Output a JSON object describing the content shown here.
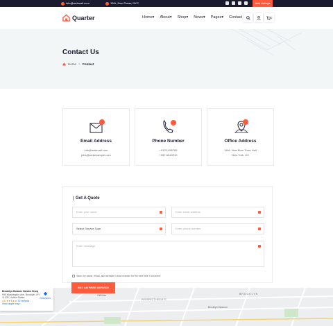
{
  "topbar": {
    "email": "info@webmail.com",
    "location": "15/A, Nest Tower, NYC",
    "add_listing": "Add Listings"
  },
  "header": {
    "logo_text": "Quarter",
    "nav": [
      "Home",
      "About",
      "Shop",
      "News",
      "Pages",
      "Contact"
    ],
    "cart_count": "2"
  },
  "banner": {
    "title": "Contact Us",
    "breadcrumb_home": "Home",
    "breadcrumb_sep": ">",
    "breadcrumb_current": "Contact"
  },
  "cards": [
    {
      "title": "Email Address",
      "line1": "info@webmail.com",
      "line2": "jobs@webexample.com",
      "icon": "email-icon"
    },
    {
      "title": "Phone Number",
      "line1": "+0123-456789",
      "line2": "+987-6543210",
      "icon": "phone-icon"
    },
    {
      "title": "Office Address",
      "line1": "18/A, New Born Town Hall",
      "line2": "New York, US",
      "icon": "location-icon"
    }
  ],
  "quote": {
    "title": "Get A Quote",
    "name_placeholder": "Enter your name",
    "email_placeholder": "Enter email address",
    "service_value": "Select Service Type",
    "phone_placeholder": "Enter phone number",
    "message_placeholder": "Enter message",
    "consent": "Save my name, email, and website in this browser for the next time I comment.",
    "submit": "GET AN FREE SERVICE"
  },
  "map": {
    "place_title": "Brooklyn Botanic Garden Shop",
    "address_line1": "990 Washington Ave, Brooklyn, NY",
    "address_line2": "11225, United States",
    "rating": "4.5",
    "reviews": "30 reviews",
    "larger_map": "View larger map",
    "directions": "Directions",
    "labels": [
      "Gift Man",
      "PROSPECT HEIGHTS",
      "BROOKLYN",
      "Brooklyn Museum"
    ]
  },
  "colors": {
    "accent": "#ff5a3c",
    "dark": "#1b1b2f",
    "banner_bg": "#f2f6f7"
  }
}
